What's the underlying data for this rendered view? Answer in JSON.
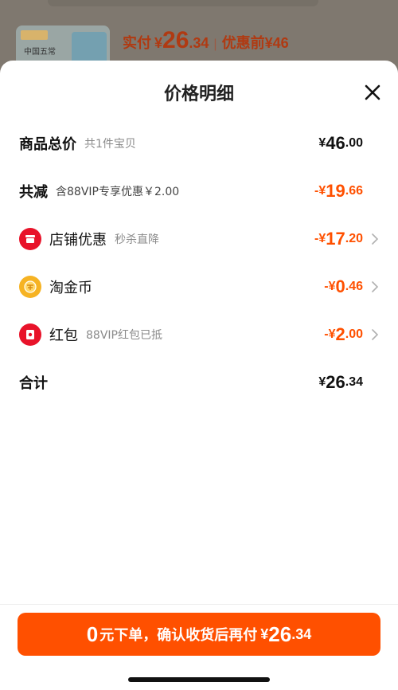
{
  "background": {
    "thumb_text": "中国五常",
    "price_label": "实付",
    "yen": "¥",
    "price_int": "26",
    "price_dec": ".34",
    "sep": "|",
    "orig_label": "优惠前",
    "orig_price": "¥46"
  },
  "sheet": {
    "title": "价格明细",
    "rows": [
      {
        "label": "商品总价",
        "sub": "共1件宝贝",
        "yen": "¥",
        "int": "46",
        "dec": ".00"
      },
      {
        "label": "共减",
        "sub": "含88VIP专享优惠￥2.00",
        "yen": "-¥",
        "int": "19",
        "dec": ".66"
      },
      {
        "label": "店铺优惠",
        "sub": "秒杀直降",
        "yen": "-¥",
        "int": "17",
        "dec": ".20"
      },
      {
        "label": "淘金币",
        "sub": "",
        "yen": "-¥",
        "int": "0",
        "dec": ".46"
      },
      {
        "label": "红包",
        "sub": "88VIP红包已抵",
        "yen": "-¥",
        "int": "2",
        "dec": ".00"
      },
      {
        "label": "合计",
        "sub": "",
        "yen": "¥",
        "int": "26",
        "dec": ".34"
      }
    ]
  },
  "cta": {
    "num": "0",
    "text": "元下单，确认收货后再付",
    "yen": "¥",
    "int": "26",
    "dec": ".34"
  },
  "colors": {
    "accent": "#ff5000",
    "overlay": "#8c7a70"
  },
  "icons": [
    "close-icon",
    "store-icon",
    "coin-icon",
    "red-packet-icon",
    "chevron-right-icon"
  ]
}
